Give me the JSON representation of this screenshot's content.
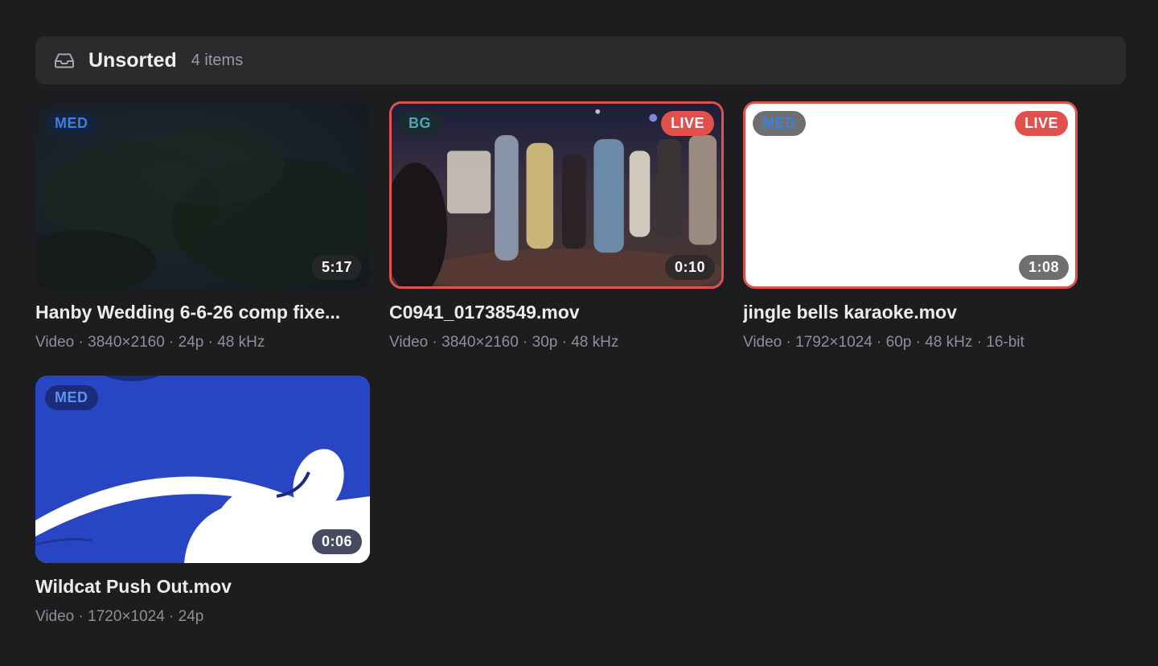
{
  "section": {
    "icon": "inbox-icon",
    "title": "Unsorted",
    "count": "4 items"
  },
  "colors": {
    "live_border": "#e0524f",
    "med_text": "#3b7fe0",
    "bg_text": "#4aa8b8"
  },
  "items": [
    {
      "tag": "MED",
      "live": "",
      "duration": "5:17",
      "title": "Hanby Wedding 6-6-26 comp fixe...",
      "meta": "Video · 3840×2160 · 24p · 48 kHz"
    },
    {
      "tag": "BG",
      "live": "LIVE",
      "duration": "0:10",
      "title": "C0941_01738549.mov",
      "meta": "Video · 3840×2160 · 30p · 48 kHz"
    },
    {
      "tag": "MED",
      "live": "LIVE",
      "duration": "1:08",
      "title": "jingle bells karaoke.mov",
      "meta": "Video · 1792×1024 · 60p · 48 kHz · 16-bit"
    },
    {
      "tag": "MED",
      "live": "",
      "duration": "0:06",
      "title": "Wildcat Push Out.mov",
      "meta": "Video · 1720×1024 · 24p"
    }
  ]
}
